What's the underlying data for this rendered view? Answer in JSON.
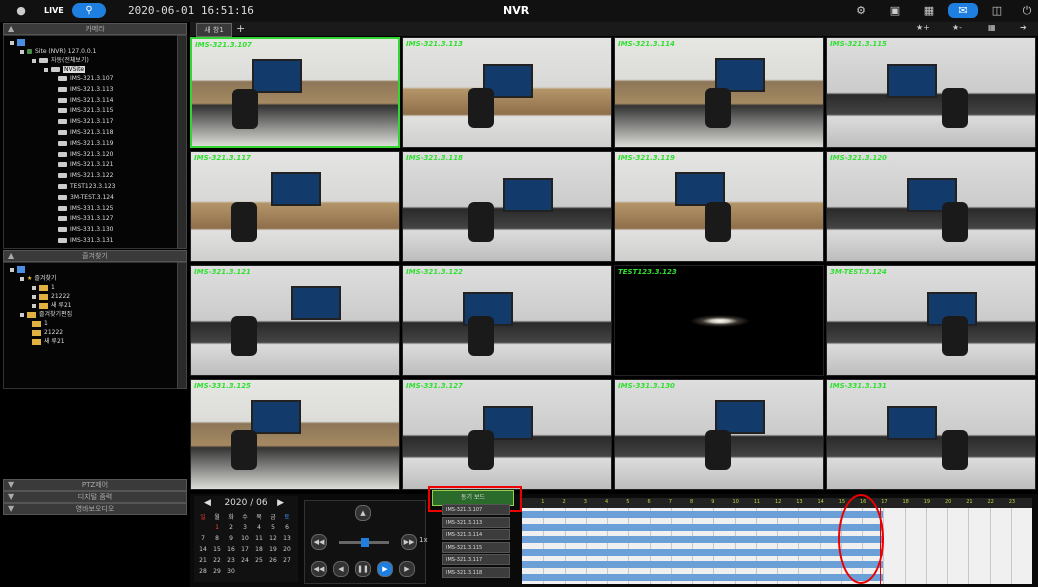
{
  "topbar": {
    "user_icon": "user-icon",
    "live_label": "LIVE",
    "search_icon": "search-icon",
    "datetime": "2020-06-01 16:51:16",
    "title": "NVR",
    "right_icons": [
      "settings-icon",
      "camera-icon",
      "grid-icon",
      "playback-icon",
      "monitor-icon",
      "power-icon"
    ]
  },
  "left": {
    "device_panel_label": "카메라",
    "device_tree": {
      "root": "",
      "site": "Site (NVR) 127.0.0.1",
      "group": "자동(전체보기)",
      "subgroup": "NVSite",
      "cameras": [
        "IMS-321.3.107",
        "IMS-321.3.113",
        "IMS-321.3.114",
        "IMS-321.3.115",
        "IMS-321.3.117",
        "IMS-321.3.118",
        "IMS-321.3.119",
        "IMS-321.3.120",
        "IMS-321.3.121",
        "IMS-321.3.122",
        "TEST123.3.123",
        "3M-TEST.3.124",
        "IMS-331.3.125",
        "IMS-331.3.127",
        "IMS-331.3.130",
        "IMS-331.3.131"
      ]
    },
    "favorites_panel_label": "즐겨찾기",
    "favorites_tree": {
      "root": "",
      "group1": "즐겨찾기",
      "group1_items": [
        "1",
        "21222",
        "새 루21"
      ],
      "group2": "즐겨찾기편집",
      "group2_items": [
        "1",
        "21222",
        "새 루21"
      ]
    },
    "collapsed_panels": [
      "PTZ제어",
      "디지털 줌력",
      "영바보오디오"
    ]
  },
  "tabbar": {
    "tab_label": "새 창1",
    "add_icon": "plus-icon",
    "right_icons": [
      "star-add-icon",
      "star-remove-icon",
      "layout-icon",
      "arrow-right-icon"
    ]
  },
  "grid": {
    "cells": [
      {
        "label": "IMS-321.3.107",
        "scene": "s1",
        "selected": true
      },
      {
        "label": "IMS-321.3.113",
        "scene": "s2",
        "selected": false
      },
      {
        "label": "IMS-321.3.114",
        "scene": "s1",
        "selected": false
      },
      {
        "label": "IMS-321.3.115",
        "scene": "s3",
        "selected": false
      },
      {
        "label": "IMS-321.3.117",
        "scene": "s2",
        "selected": false
      },
      {
        "label": "IMS-321.3.118",
        "scene": "s3",
        "selected": false
      },
      {
        "label": "IMS-321.3.119",
        "scene": "s2",
        "selected": false
      },
      {
        "label": "IMS-321.3.120",
        "scene": "s3",
        "selected": false
      },
      {
        "label": "IMS-321.3.121",
        "scene": "s3",
        "selected": false
      },
      {
        "label": "IMS-321.3.122",
        "scene": "s3",
        "selected": false
      },
      {
        "label": "TEST123.3.123",
        "scene": "dark",
        "selected": false
      },
      {
        "label": "3M-TEST.3.124",
        "scene": "s3",
        "selected": false
      },
      {
        "label": "IMS-331.3.125",
        "scene": "s1",
        "selected": false
      },
      {
        "label": "IMS-331.3.127",
        "scene": "s3",
        "selected": false
      },
      {
        "label": "IMS-331.3.130",
        "scene": "s3",
        "selected": false
      },
      {
        "label": "IMS-331.3.131",
        "scene": "s3",
        "selected": false
      }
    ]
  },
  "calendar": {
    "month_label": "2020 / 06",
    "prev_icon": "chevron-left-icon",
    "next_icon": "chevron-right-icon",
    "weekdays": [
      "일",
      "월",
      "화",
      "수",
      "목",
      "금",
      "토"
    ],
    "weeks": [
      [
        "",
        "1",
        "2",
        "3",
        "4",
        "5",
        "6"
      ],
      [
        "7",
        "8",
        "9",
        "10",
        "11",
        "12",
        "13"
      ],
      [
        "14",
        "15",
        "16",
        "17",
        "18",
        "19",
        "20"
      ],
      [
        "21",
        "22",
        "23",
        "24",
        "25",
        "26",
        "27"
      ],
      [
        "28",
        "29",
        "30",
        "",
        "",
        "",
        ""
      ]
    ]
  },
  "playback": {
    "speed_value": "1x",
    "buttons": [
      "step-back-icon",
      "rewind-icon",
      "prev-frame-icon",
      "pause-icon",
      "play-icon",
      "next-frame-icon",
      "fast-forward-icon",
      "step-forward-icon"
    ]
  },
  "timeline": {
    "backup_label": "동기 보드",
    "camera_rows": [
      "IMS-321.3.107",
      "IMS-321.3.113",
      "IMS-321.3.114",
      "IMS-321.3.115",
      "IMS-321.3.117",
      "IMS-321.3.118"
    ],
    "hours": [
      "1",
      "2",
      "3",
      "4",
      "5",
      "6",
      "7",
      "8",
      "9",
      "10",
      "11",
      "12",
      "13",
      "14",
      "15",
      "16",
      "17",
      "18",
      "19",
      "20",
      "21",
      "22",
      "23"
    ],
    "recording_end_hour": 17,
    "cursor_hour": 16.86
  }
}
